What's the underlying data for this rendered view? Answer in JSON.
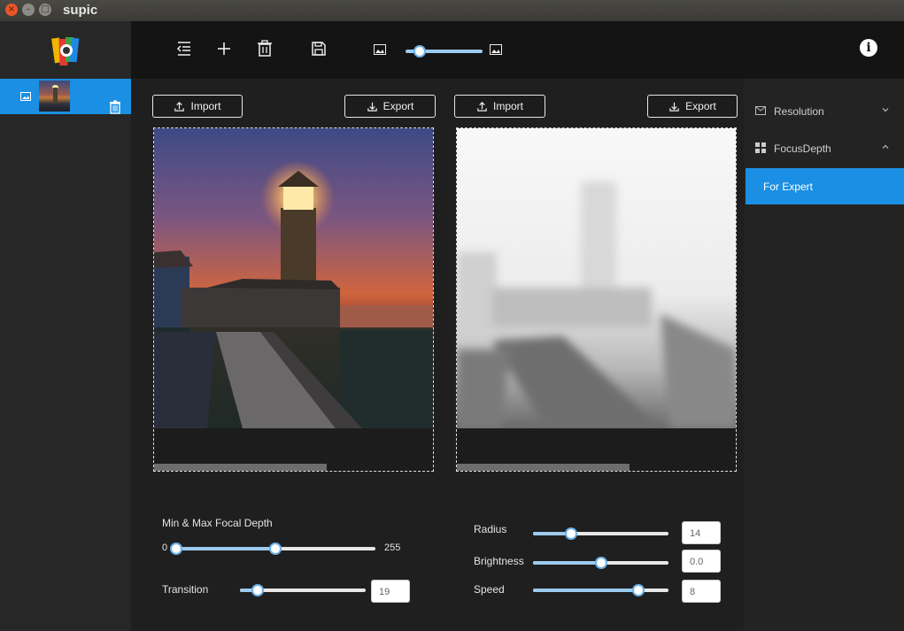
{
  "window": {
    "title": "supic",
    "controls": {
      "close": "×",
      "minimize": "–",
      "maximize": "□"
    }
  },
  "sidebar": {
    "items": [
      {
        "thumbnail": "lighthouse"
      }
    ]
  },
  "toolbar": {
    "icons": [
      "collapse-icon",
      "add-icon",
      "trash-icon",
      "save-icon",
      "image-small-icon",
      "image-large-icon",
      "info-icon"
    ],
    "zoom": 0.18,
    "info_label": "i"
  },
  "panels": {
    "left": {
      "import_label": "Import",
      "export_label": "Export",
      "scroll_fraction": 0.62
    },
    "right": {
      "import_label": "Import",
      "export_label": "Export",
      "scroll_fraction": 0.62
    }
  },
  "controls": {
    "focal": {
      "label": "Min & Max Focal Depth",
      "min_value": "0",
      "max_value": "255",
      "low": 0,
      "high": 127
    },
    "transition": {
      "label": "Transition",
      "value": "19",
      "fraction": 0.14
    },
    "radius": {
      "label": "Radius",
      "value": "14",
      "fraction": 0.28
    },
    "brightness": {
      "label": "Brightness",
      "value": "0.0",
      "fraction": 0.5
    },
    "speed": {
      "label": "Speed",
      "value": "8",
      "fraction": 0.78
    }
  },
  "right_panel": {
    "resolution_label": "Resolution",
    "focusdepth_label": "FocusDepth",
    "selected_label": "For Expert"
  },
  "colors": {
    "accent": "#1a8fe3",
    "slider_fill": "#9ccbf0",
    "toolbar": "#141414"
  }
}
